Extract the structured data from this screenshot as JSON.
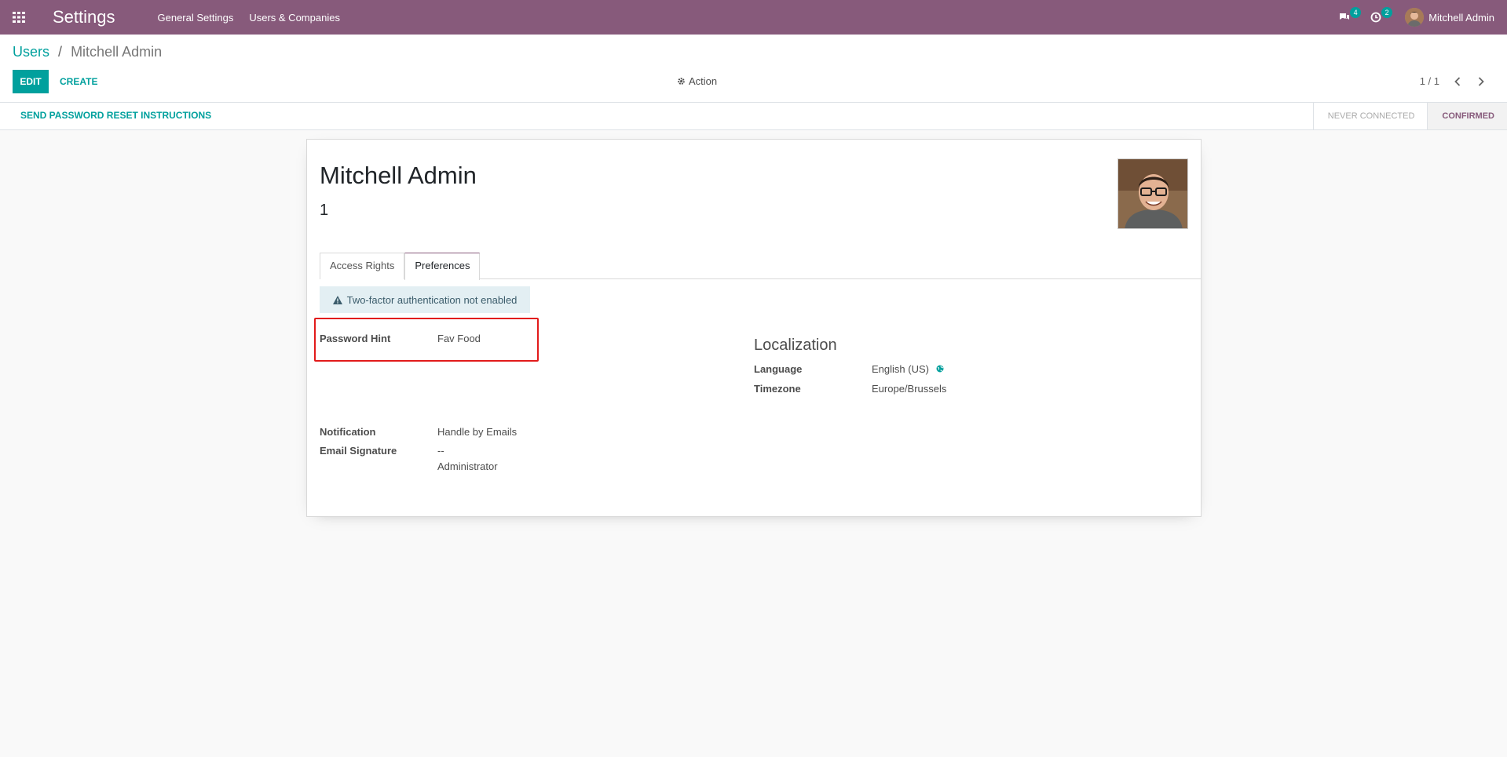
{
  "navbar": {
    "brand": "Settings",
    "menu": [
      "General Settings",
      "Users & Companies"
    ],
    "messages_count": "4",
    "activities_count": "2",
    "user_name": "Mitchell Admin",
    "color": "#875a7b"
  },
  "breadcrumb": {
    "parent": "Users",
    "separator": "/",
    "current": "Mitchell Admin"
  },
  "buttons": {
    "edit": "EDIT",
    "create": "CREATE",
    "action": "Action",
    "send_reset": "SEND PASSWORD RESET INSTRUCTIONS"
  },
  "pager": {
    "value": "1 / 1"
  },
  "stages": [
    {
      "label": "NEVER CONNECTED",
      "active": false
    },
    {
      "label": "CONFIRMED",
      "active": true
    }
  ],
  "record": {
    "name": "Mitchell Admin",
    "login": "1"
  },
  "tabs": [
    {
      "label": "Access Rights",
      "active": false
    },
    {
      "label": "Preferences",
      "active": true
    }
  ],
  "alert": {
    "text": "Two-factor authentication not enabled"
  },
  "fields": {
    "password_hint": {
      "label": "Password Hint",
      "value": "Fav Food"
    },
    "localization_title": "Localization",
    "language": {
      "label": "Language",
      "value": "English (US)"
    },
    "timezone": {
      "label": "Timezone",
      "value": "Europe/Brussels"
    },
    "notification": {
      "label": "Notification",
      "value": "Handle by Emails"
    },
    "email_signature": {
      "label": "Email Signature",
      "line1": "--",
      "line2": "Administrator"
    }
  },
  "colors": {
    "accent": "#00a09d",
    "highlight": "#e21b1b"
  }
}
